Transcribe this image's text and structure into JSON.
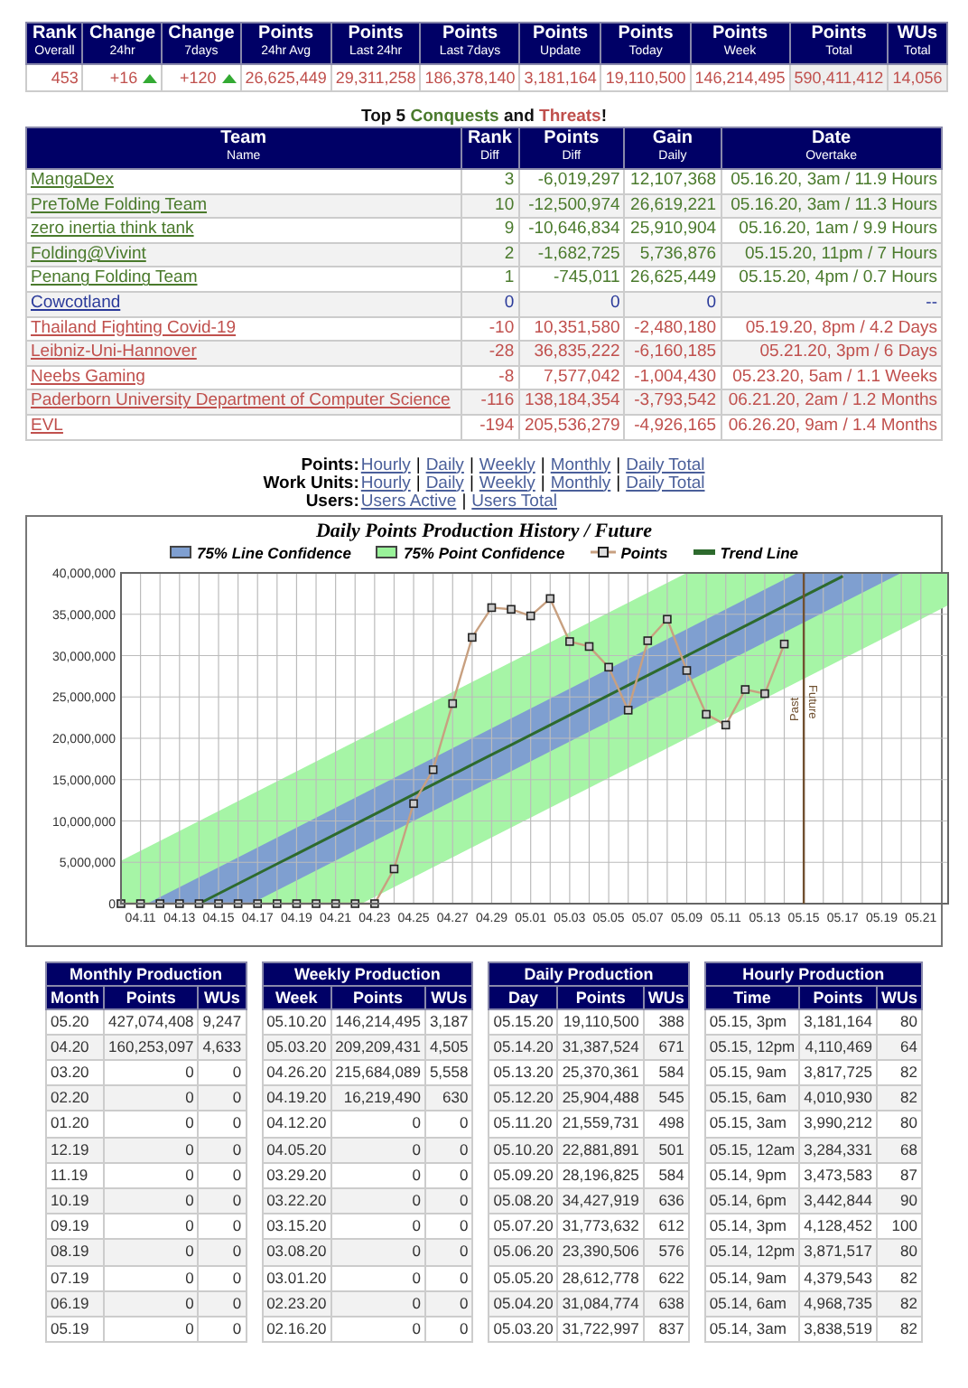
{
  "summary": {
    "columns": [
      {
        "title": "Rank",
        "sub": "Overall"
      },
      {
        "title": "Change",
        "sub": "24hr"
      },
      {
        "title": "Change",
        "sub": "7days"
      },
      {
        "title": "Points",
        "sub": "24hr Avg"
      },
      {
        "title": "Points",
        "sub": "Last 24hr"
      },
      {
        "title": "Points",
        "sub": "Last 7days"
      },
      {
        "title": "Points",
        "sub": "Update"
      },
      {
        "title": "Points",
        "sub": "Today"
      },
      {
        "title": "Points",
        "sub": "Week"
      },
      {
        "title": "Points",
        "sub": "Total"
      },
      {
        "title": "WUs",
        "sub": "Total"
      }
    ],
    "values": [
      {
        "text": "453",
        "arrow_up": false
      },
      {
        "text": "+16",
        "arrow_up": true
      },
      {
        "text": "+120",
        "arrow_up": true
      },
      {
        "text": "26,625,449",
        "arrow_up": false
      },
      {
        "text": "29,311,258",
        "arrow_up": false
      },
      {
        "text": "186,378,140",
        "arrow_up": false
      },
      {
        "text": "3,181,164",
        "arrow_up": false
      },
      {
        "text": "19,110,500",
        "arrow_up": false
      },
      {
        "text": "146,214,495",
        "arrow_up": false
      },
      {
        "text": "590,411,412",
        "arrow_up": false
      },
      {
        "text": "14,056",
        "arrow_up": false
      }
    ]
  },
  "rivals": {
    "title": [
      {
        "text": "Top 5 ",
        "kind": "plain"
      },
      {
        "text": "Conquests",
        "kind": "conquest"
      },
      {
        "text": " and ",
        "kind": "plain"
      },
      {
        "text": "Threats",
        "kind": "threat"
      },
      {
        "text": "!",
        "kind": "plain"
      }
    ],
    "columns": [
      {
        "title": "Team",
        "sub": "Name"
      },
      {
        "title": "Rank",
        "sub": "Diff"
      },
      {
        "title": "Points",
        "sub": "Diff"
      },
      {
        "title": "Gain",
        "sub": "Daily"
      },
      {
        "title": "Date",
        "sub": "Overtake"
      }
    ],
    "rows": [
      {
        "kind": "conquest",
        "team": "MangaDex",
        "rank": "3",
        "points": "-6,019,297",
        "gain": "12,107,368",
        "date": "05.16.20, 3am / 11.9 Hours"
      },
      {
        "kind": "conquest",
        "team": "PreToMe Folding Team",
        "rank": "10",
        "points": "-12,500,974",
        "gain": "26,619,221",
        "date": "05.16.20, 3am / 11.3 Hours"
      },
      {
        "kind": "conquest",
        "team": "zero inertia think tank",
        "rank": "9",
        "points": "-10,646,834",
        "gain": "25,910,904",
        "date": "05.16.20, 1am / 9.9 Hours"
      },
      {
        "kind": "conquest",
        "team": "Folding@Vivint",
        "rank": "2",
        "points": "-1,682,725",
        "gain": "5,736,876",
        "date": "05.15.20, 11pm / 7 Hours"
      },
      {
        "kind": "conquest",
        "team": "Penang Folding Team",
        "rank": "1",
        "points": "-745,011",
        "gain": "26,625,449",
        "date": "05.15.20, 4pm / 0.7 Hours"
      },
      {
        "kind": "self",
        "team": "Cowcotland",
        "rank": "0",
        "points": "0",
        "gain": "0",
        "date": "--"
      },
      {
        "kind": "threat",
        "team": "Thailand Fighting Covid-19",
        "rank": "-10",
        "points": "10,351,580",
        "gain": "-2,480,180",
        "date": "05.19.20, 8pm / 4.2 Days"
      },
      {
        "kind": "threat",
        "team": "Leibniz-Uni-Hannover",
        "rank": "-28",
        "points": "36,835,222",
        "gain": "-6,160,185",
        "date": "05.21.20, 3pm / 6 Days"
      },
      {
        "kind": "threat",
        "team": "Neebs Gaming",
        "rank": "-8",
        "points": "7,577,042",
        "gain": "-1,004,430",
        "date": "05.23.20, 5am / 1.1 Weeks"
      },
      {
        "kind": "threat",
        "team": "Paderborn University Department of Computer Science",
        "rank": "-116",
        "points": "138,184,354",
        "gain": "-3,793,542",
        "date": "06.21.20, 2am / 1.2 Months"
      },
      {
        "kind": "threat",
        "team": "EVL",
        "rank": "-194",
        "points": "205,536,279",
        "gain": "-4,926,165",
        "date": "06.26.20, 9am / 1.4 Months"
      }
    ]
  },
  "links": [
    {
      "label": "Points:",
      "items": [
        "Hourly",
        "Daily",
        "Weekly",
        "Monthly",
        "Daily Total"
      ],
      "separator": "|"
    },
    {
      "label": "Work Units:",
      "items": [
        "Hourly",
        "Daily",
        "Weekly",
        "Monthly",
        "Daily Total"
      ],
      "separator": "|"
    },
    {
      "label": "Users:",
      "items": [
        "Users Active",
        "Users Total"
      ],
      "separator": "|"
    }
  ],
  "chart": {
    "legend": [
      {
        "kind": "line_band",
        "label": "75% Line Confidence"
      },
      {
        "kind": "point_band",
        "label": "75% Point Confidence"
      }
    ],
    "chart_data": {
      "type": "line",
      "title": "Daily Points Production History / Future",
      "categories": [
        null,
        "04.11",
        null,
        "04.13",
        null,
        "04.15",
        null,
        "04.17",
        null,
        "04.19",
        null,
        "04.21",
        null,
        "04.23",
        null,
        "04.25",
        null,
        "04.27",
        null,
        "04.29",
        null,
        "05.01",
        null,
        "05.03",
        null,
        "05.05",
        null,
        "05.07",
        null,
        "05.09",
        null,
        "05.11",
        null,
        "05.13",
        null,
        "05.15",
        null,
        "05.17",
        null,
        "05.19",
        null,
        "05.21"
      ],
      "grid": true,
      "ylim": [
        0,
        40000000
      ],
      "yticks": [
        {
          "value": 0,
          "label": "0"
        },
        {
          "value": 5000000,
          "label": "5,000,000"
        },
        {
          "value": 10000000,
          "label": "10,000,000"
        },
        {
          "value": 15000000,
          "label": "15,000,000"
        },
        {
          "value": 20000000,
          "label": "20,000,000"
        },
        {
          "value": 25000000,
          "label": "25,000,000"
        },
        {
          "value": 30000000,
          "label": "30,000,000"
        },
        {
          "value": 35000000,
          "label": "35,000,000"
        },
        {
          "value": 40000000,
          "label": "40,000,000"
        }
      ],
      "series": [
        {
          "name": "Points",
          "color": "#c8a080",
          "marker": "square",
          "values": [
            0,
            0,
            0,
            0,
            0,
            0,
            0,
            0,
            0,
            0,
            0,
            0,
            0,
            0,
            4200000,
            12100000,
            16200000,
            24200000,
            32200000,
            35800000,
            35600000,
            34800000,
            36900000,
            31700000,
            31100000,
            28600000,
            23400000,
            31800000,
            34400000,
            28200000,
            22900000,
            21600000,
            25900000,
            25400000,
            31400000,
            null,
            null,
            null,
            null,
            null,
            null,
            null
          ]
        },
        {
          "name": "Trend Line",
          "color": "#2d6a2d",
          "values": [
            null,
            null,
            null,
            null,
            0,
            1200000,
            2400000,
            3600000,
            4800000,
            6000000,
            7200000,
            8400000,
            9600000,
            10800000,
            12000000,
            13200000,
            14400000,
            15600000,
            16800000,
            18000000,
            19200000,
            20400000,
            21600000,
            22800000,
            24000000,
            25200000,
            26400000,
            27600000,
            28800000,
            30000000,
            31200000,
            32400000,
            33600000,
            34800000,
            36000000,
            37200000,
            38400000,
            39600000,
            null,
            null,
            null,
            null
          ]
        }
      ],
      "ref_lines": [
        {
          "axis": "x",
          "value": "05.15",
          "color": "#705030"
        }
      ],
      "annotations": [
        {
          "x": "05.15",
          "text": "Past"
        },
        {
          "x": "05.15",
          "text": "Future"
        }
      ]
    }
  },
  "production": [
    {
      "title": "Monthly Production",
      "columns": [
        "Month",
        "Points",
        "WUs"
      ],
      "rows": [
        [
          "05.20",
          "427,074,408",
          "9,247"
        ],
        [
          "04.20",
          "160,253,097",
          "4,633"
        ],
        [
          "03.20",
          "0",
          "0"
        ],
        [
          "02.20",
          "0",
          "0"
        ],
        [
          "01.20",
          "0",
          "0"
        ],
        [
          "12.19",
          "0",
          "0"
        ],
        [
          "11.19",
          "0",
          "0"
        ],
        [
          "10.19",
          "0",
          "0"
        ],
        [
          "09.19",
          "0",
          "0"
        ],
        [
          "08.19",
          "0",
          "0"
        ],
        [
          "07.19",
          "0",
          "0"
        ],
        [
          "06.19",
          "0",
          "0"
        ],
        [
          "05.19",
          "0",
          "0"
        ]
      ]
    },
    {
      "title": "Weekly Production",
      "columns": [
        "Week",
        "Points",
        "WUs"
      ],
      "rows": [
        [
          "05.10.20",
          "146,214,495",
          "3,187"
        ],
        [
          "05.03.20",
          "209,209,431",
          "4,505"
        ],
        [
          "04.26.20",
          "215,684,089",
          "5,558"
        ],
        [
          "04.19.20",
          "16,219,490",
          "630"
        ],
        [
          "04.12.20",
          "0",
          "0"
        ],
        [
          "04.05.20",
          "0",
          "0"
        ],
        [
          "03.29.20",
          "0",
          "0"
        ],
        [
          "03.22.20",
          "0",
          "0"
        ],
        [
          "03.15.20",
          "0",
          "0"
        ],
        [
          "03.08.20",
          "0",
          "0"
        ],
        [
          "03.01.20",
          "0",
          "0"
        ],
        [
          "02.23.20",
          "0",
          "0"
        ],
        [
          "02.16.20",
          "0",
          "0"
        ]
      ]
    },
    {
      "title": "Daily Production",
      "columns": [
        "Day",
        "Points",
        "WUs"
      ],
      "rows": [
        [
          "05.15.20",
          "19,110,500",
          "388"
        ],
        [
          "05.14.20",
          "31,387,524",
          "671"
        ],
        [
          "05.13.20",
          "25,370,361",
          "584"
        ],
        [
          "05.12.20",
          "25,904,488",
          "545"
        ],
        [
          "05.11.20",
          "21,559,731",
          "498"
        ],
        [
          "05.10.20",
          "22,881,891",
          "501"
        ],
        [
          "05.09.20",
          "28,196,825",
          "584"
        ],
        [
          "05.08.20",
          "34,427,919",
          "636"
        ],
        [
          "05.07.20",
          "31,773,632",
          "612"
        ],
        [
          "05.06.20",
          "23,390,506",
          "576"
        ],
        [
          "05.05.20",
          "28,612,778",
          "622"
        ],
        [
          "05.04.20",
          "31,084,774",
          "638"
        ],
        [
          "05.03.20",
          "31,722,997",
          "837"
        ]
      ]
    },
    {
      "title": "Hourly Production",
      "columns": [
        "Time",
        "Points",
        "WUs"
      ],
      "rows": [
        [
          "05.15, 3pm",
          "3,181,164",
          "80"
        ],
        [
          "05.15, 12pm",
          "4,110,469",
          "64"
        ],
        [
          "05.15, 9am",
          "3,817,725",
          "82"
        ],
        [
          "05.15, 6am",
          "4,010,930",
          "82"
        ],
        [
          "05.15, 3am",
          "3,990,212",
          "80"
        ],
        [
          "05.15, 12am",
          "3,284,331",
          "68"
        ],
        [
          "05.14, 9pm",
          "3,473,583",
          "87"
        ],
        [
          "05.14, 6pm",
          "3,442,844",
          "90"
        ],
        [
          "05.14, 3pm",
          "4,128,452",
          "100"
        ],
        [
          "05.14, 12pm",
          "3,871,517",
          "80"
        ],
        [
          "05.14, 9am",
          "4,379,543",
          "82"
        ],
        [
          "05.14, 6am",
          "4,968,735",
          "82"
        ],
        [
          "05.14, 3am",
          "3,838,519",
          "82"
        ]
      ]
    }
  ]
}
